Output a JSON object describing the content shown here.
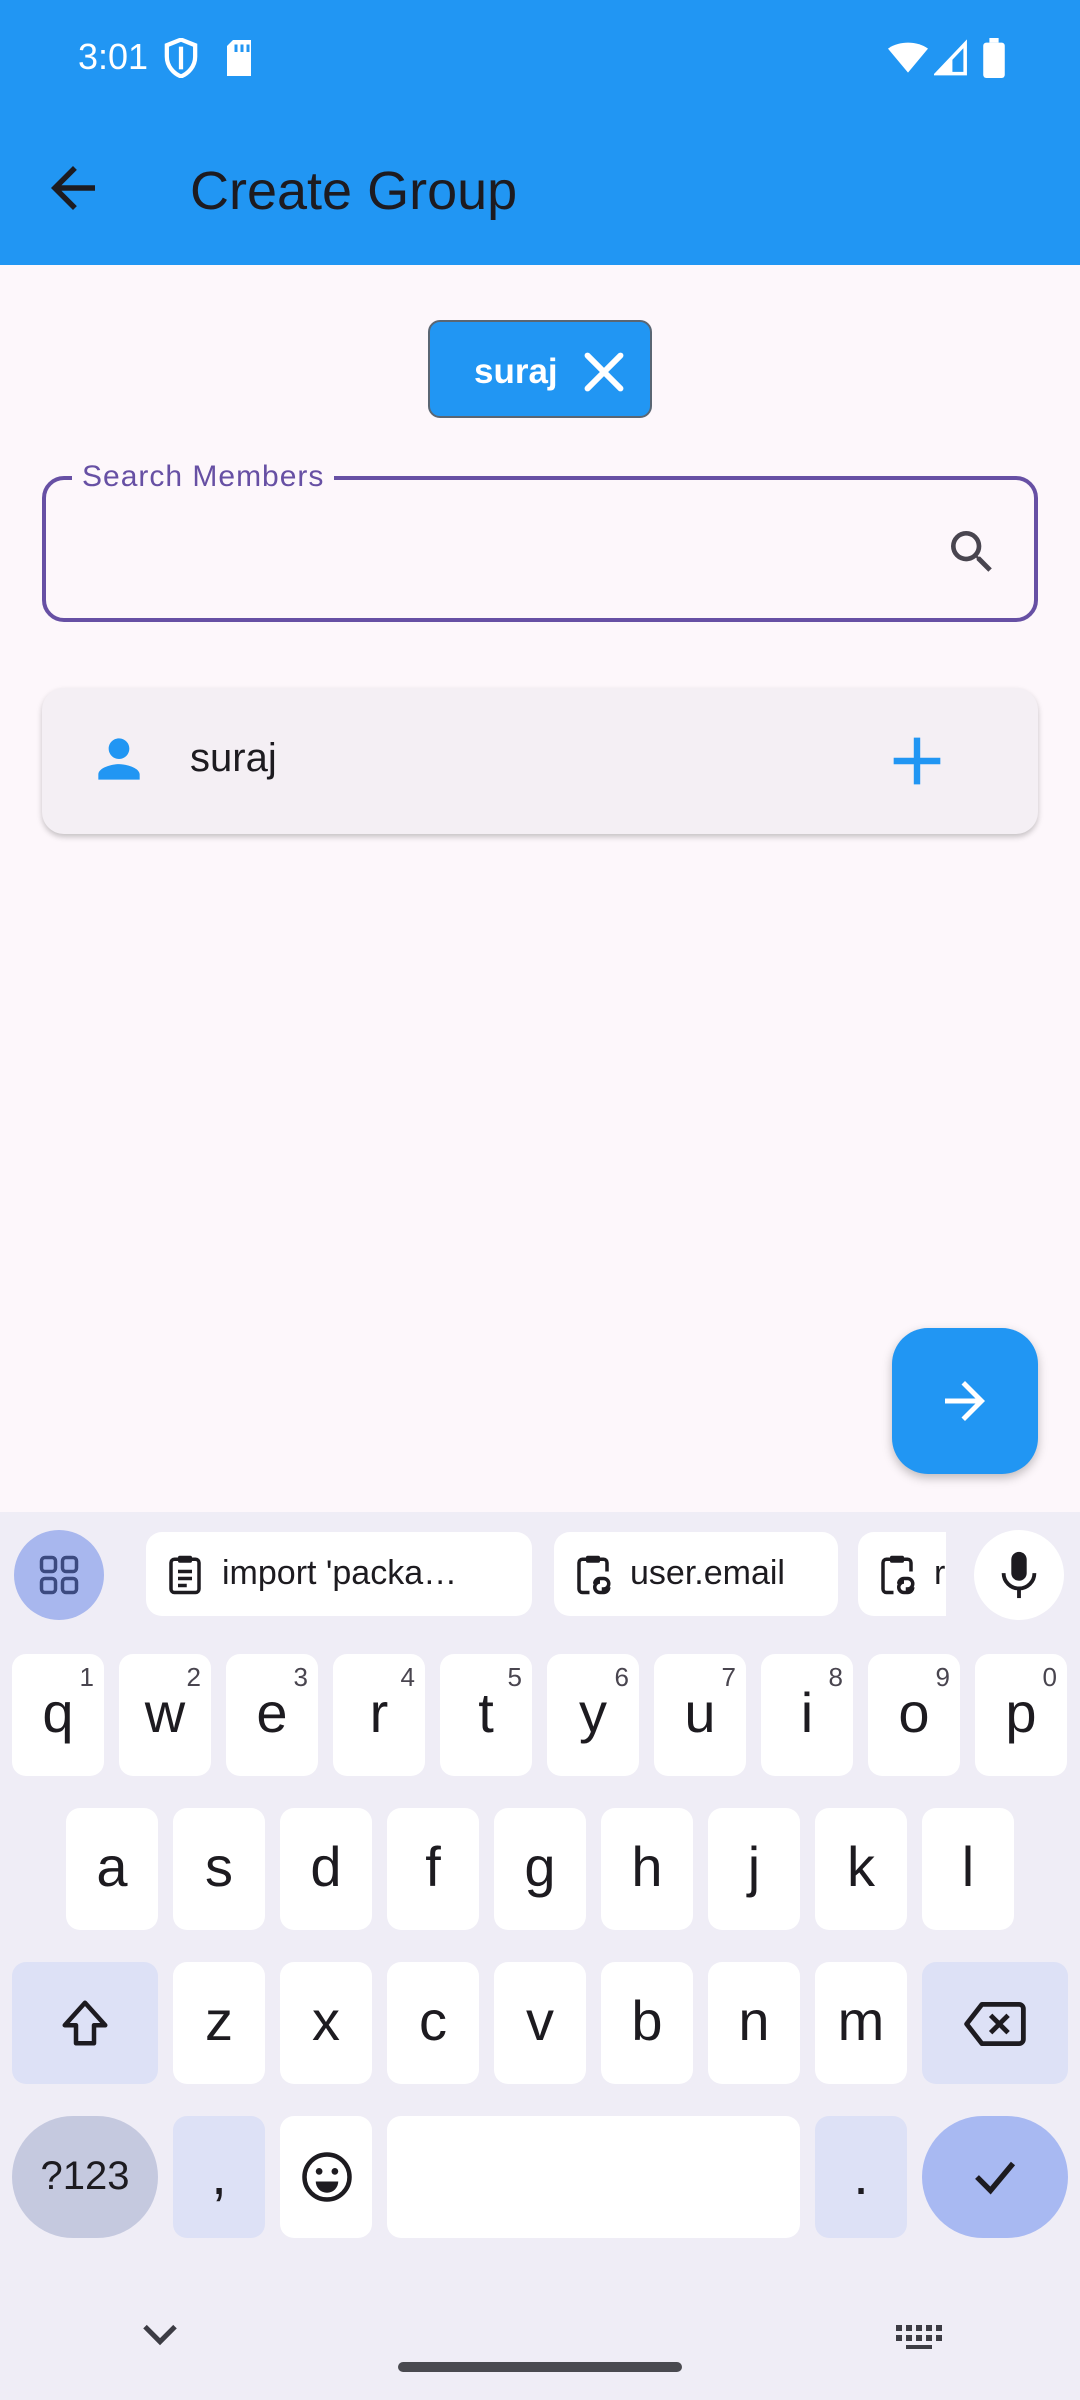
{
  "status_bar": {
    "time": "3:01",
    "icons": [
      "shield-icon",
      "sd-card-icon",
      "wifi-icon",
      "signal-icon",
      "battery-icon"
    ]
  },
  "app_bar": {
    "title": "Create Group",
    "back_icon": "arrow-back-icon",
    "background": "#2196f3"
  },
  "selected_members": [
    {
      "label": "suraj",
      "remove_icon": "close-icon"
    }
  ],
  "search": {
    "label": "Search Members",
    "value": "",
    "icon": "search-icon",
    "accent": "#6750a4"
  },
  "members": [
    {
      "name": "suraj",
      "icon": "person-icon",
      "action_icon": "add-icon"
    }
  ],
  "fab": {
    "icon": "arrow-forward-icon"
  },
  "keyboard": {
    "clipboard": [
      {
        "text": "import 'packa…",
        "icon": "clipboard-icon"
      },
      {
        "text": "user.email",
        "icon": "clipboard-link-icon"
      },
      {
        "text": "r",
        "icon": "clipboard-link-icon"
      }
    ],
    "row1": [
      {
        "k": "q",
        "h": "1"
      },
      {
        "k": "w",
        "h": "2"
      },
      {
        "k": "e",
        "h": "3"
      },
      {
        "k": "r",
        "h": "4"
      },
      {
        "k": "t",
        "h": "5"
      },
      {
        "k": "y",
        "h": "6"
      },
      {
        "k": "u",
        "h": "7"
      },
      {
        "k": "i",
        "h": "8"
      },
      {
        "k": "o",
        "h": "9"
      },
      {
        "k": "p",
        "h": "0"
      }
    ],
    "row2": [
      "a",
      "s",
      "d",
      "f",
      "g",
      "h",
      "j",
      "k",
      "l"
    ],
    "row3": [
      "z",
      "x",
      "c",
      "v",
      "b",
      "n",
      "m"
    ],
    "symbols_key": "?123",
    "comma_key": ",",
    "period_key": "."
  }
}
